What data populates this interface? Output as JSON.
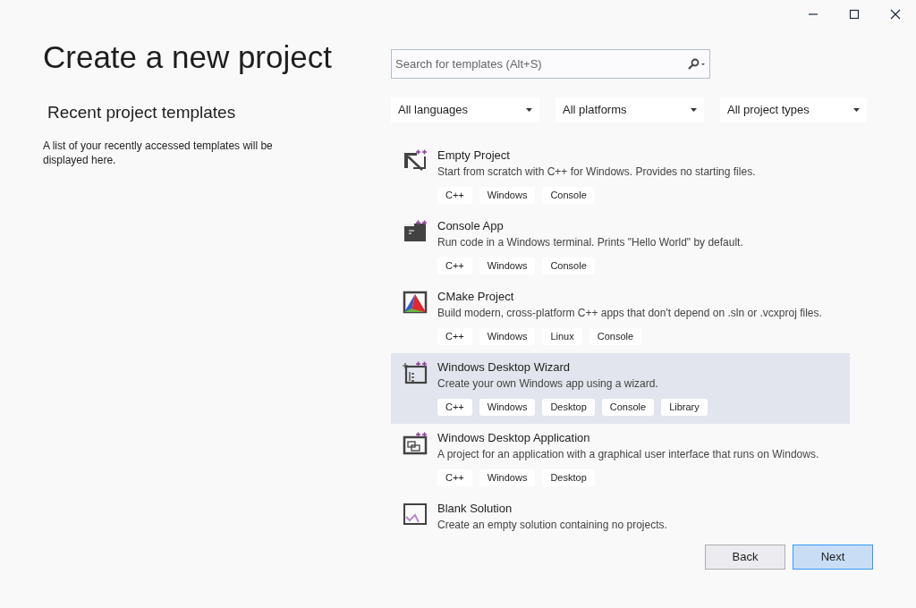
{
  "title": "Create a new project",
  "recent": {
    "heading": "Recent project templates",
    "text": "A list of your recently accessed templates will be displayed here."
  },
  "search": {
    "placeholder": "Search for templates (Alt+S)"
  },
  "filters": [
    "All languages",
    "All platforms",
    "All project types"
  ],
  "templates": [
    {
      "name": "Empty Project",
      "description": "Start from scratch with C++ for Windows. Provides no starting files.",
      "tags": [
        "C++",
        "Windows",
        "Console"
      ],
      "selected": false
    },
    {
      "name": "Console App",
      "description": "Run code in a Windows terminal. Prints \"Hello World\" by default.",
      "tags": [
        "C++",
        "Windows",
        "Console"
      ],
      "selected": false
    },
    {
      "name": "CMake Project",
      "description": "Build modern, cross-platform C++ apps that don't depend on .sln or .vcxproj files.",
      "tags": [
        "C++",
        "Windows",
        "Linux",
        "Console"
      ],
      "selected": false
    },
    {
      "name": "Windows Desktop Wizard",
      "description": "Create your own Windows app using a wizard.",
      "tags": [
        "C++",
        "Windows",
        "Desktop",
        "Console",
        "Library"
      ],
      "selected": true
    },
    {
      "name": "Windows Desktop Application",
      "description": "A project for an application with a graphical user interface that runs on Windows.",
      "tags": [
        "C++",
        "Windows",
        "Desktop"
      ],
      "selected": false
    },
    {
      "name": "Blank Solution",
      "description": "Create an empty solution containing no projects.",
      "selected": false
    }
  ],
  "buttons": {
    "back": "Back",
    "next": "Next"
  }
}
